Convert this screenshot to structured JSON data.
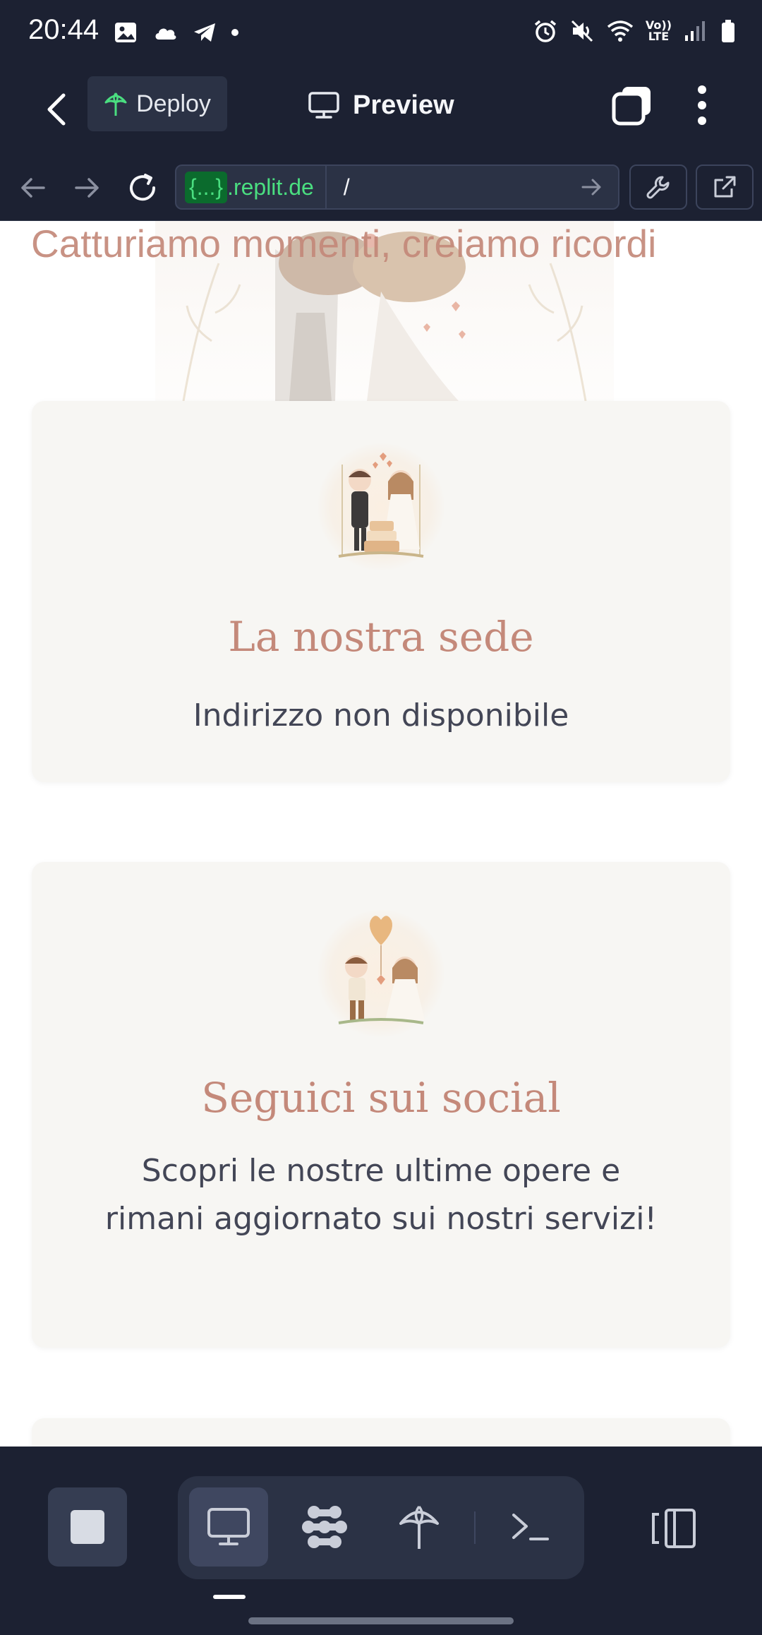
{
  "status_bar": {
    "time": "20:44",
    "left_icons": [
      "image-icon",
      "cloud-icon",
      "telegram-icon",
      "dot-icon"
    ],
    "right_icons": [
      "alarm-icon",
      "mute-icon",
      "wifi-icon",
      "volte-icon",
      "signal-icon",
      "battery-icon"
    ],
    "volte_top": "Vo))",
    "volte_bottom": "LTE"
  },
  "app_bar": {
    "deploy_label": "Deploy",
    "title": "Preview"
  },
  "browser_bar": {
    "url_badge": "{...}",
    "url_domain": ".replit.de",
    "url_path": "/"
  },
  "page": {
    "hero_title": "Catturiamo momenti, creiamo ricordi",
    "cards": [
      {
        "title": "La nostra sede",
        "text": "Indirizzo non disponibile"
      },
      {
        "title": "Seguici sui social",
        "text": "Scopri le nostre ultime opere e rimani aggiornato sui nostri servizi!"
      }
    ]
  },
  "bottom_bar": {
    "stop_icon": "stop-icon",
    "tools": [
      "preview-icon",
      "workspace-icon",
      "deploy-icon",
      "shell-icon"
    ],
    "side_icon": "panel-switch-icon"
  },
  "colors": {
    "chrome_bg": "#1c2132",
    "accent_green": "#4ade80",
    "title_rose": "#c4897a",
    "card_bg": "#f7f6f3"
  }
}
